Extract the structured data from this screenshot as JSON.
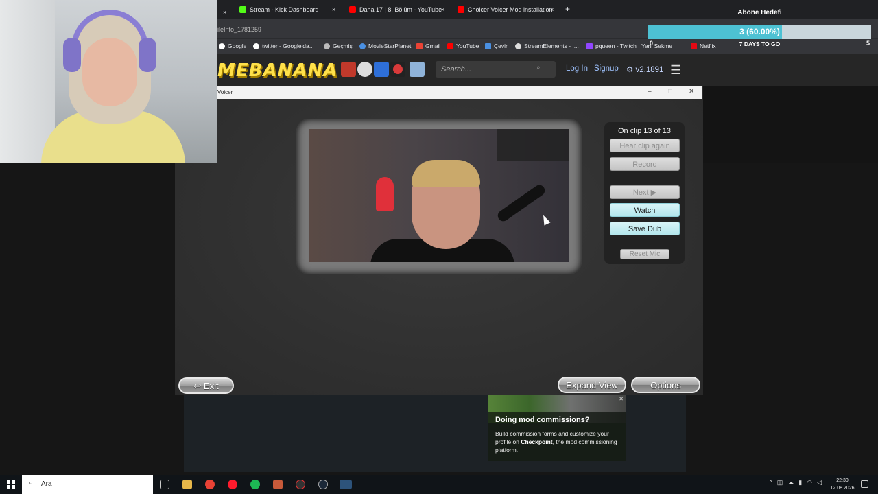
{
  "browser": {
    "tabs": [
      {
        "label": "Stream - Kick Dashboard",
        "color": "#53fc18"
      },
      {
        "label": "Daha 17 | 8. Bölüm - YouTube",
        "color": "#ff0000"
      },
      {
        "label": "Choicer Voicer Mod installation",
        "color": "#ff0000"
      }
    ],
    "new_tab": "+",
    "close": "×",
    "url_fragment": "ileInfo_1781259",
    "bookmarks": [
      {
        "label": "Google",
        "color": "#ffffff"
      },
      {
        "label": "twitter - Google'da...",
        "color": "#ffffff"
      },
      {
        "label": "Geçmiş",
        "color": "#bbbbbb"
      },
      {
        "label": "MovieStarPlanet",
        "color": "#4a90e2"
      },
      {
        "label": "Gmail",
        "color": "#ea4335"
      },
      {
        "label": "YouTube",
        "color": "#ff0000"
      },
      {
        "label": "Çevir",
        "color": "#4a90e2"
      },
      {
        "label": "StreamElements - I...",
        "color": "#dddddd"
      },
      {
        "label": "pqueen - Twitch",
        "color": "#9146ff"
      },
      {
        "label": "Yeni Sekme",
        "color": "#dddddd"
      },
      {
        "label": "Netflix",
        "color": "#e50914"
      }
    ]
  },
  "goal": {
    "title": "Abone Hedefi",
    "value_text": "3 (60.00%)",
    "progress": 0.6,
    "min": "0",
    "max": "5",
    "days_left": "7 DAYS TO GO"
  },
  "site": {
    "logo": "MEBANANA",
    "search_placeholder": "Search...",
    "login": "Log In",
    "signup": "Signup",
    "version": "v2.1891",
    "menu_icon": "hamburger-icon"
  },
  "dialog": {
    "title": "Voicer",
    "minimize": "–",
    "maximize": "□",
    "close": "✕"
  },
  "voicer": {
    "clip_status": "On clip 13 of 13",
    "buttons": {
      "hear_again": "Hear clip again",
      "record": "Record",
      "next": "Next ▶",
      "watch": "Watch",
      "save_dub": "Save Dub",
      "reset_mic": "Reset Mic"
    },
    "exit": "↩ Exit",
    "expand_view": "Expand View",
    "options": "Options"
  },
  "ad": {
    "title": "Doing mod commissions?",
    "body_prefix": "Build commission forms and customize your profile on ",
    "body_brand": "Checkpoint",
    "body_suffix": ", the mod commissioning platform.",
    "close": "✕"
  },
  "taskbar": {
    "search_text": "Ara",
    "time": "22:30",
    "date": "12.08.2026"
  }
}
